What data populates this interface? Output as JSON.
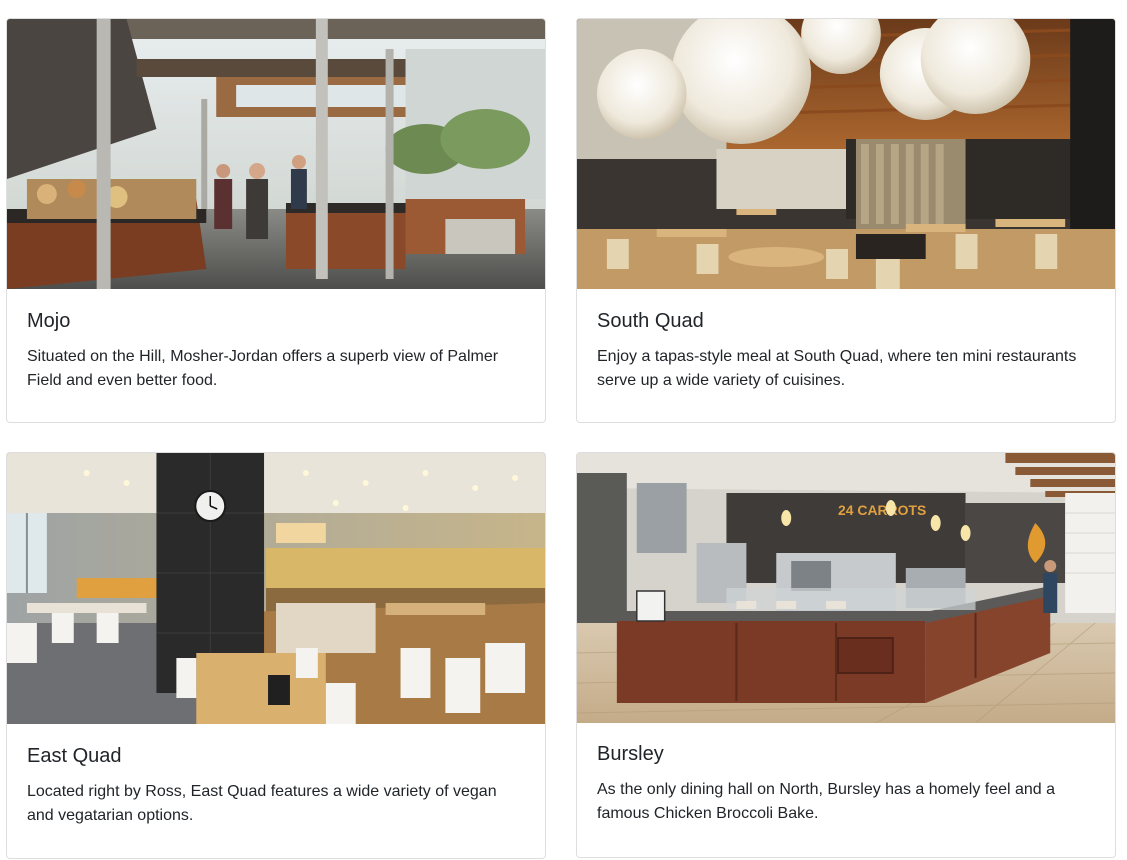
{
  "cards": [
    {
      "title": "Mojo",
      "text": "Situated on the Hill, Mosher-Jordan offers a superb view of Palmer Field and even better food.",
      "image": "mojo-dining-hall-photo"
    },
    {
      "title": "South Quad",
      "text": "Enjoy a tapas-style meal at South Quad, where ten mini restaurants serve up a wide variety of cuisines.",
      "image": "south-quad-dining-hall-photo"
    },
    {
      "title": "East Quad",
      "text": "Located right by Ross, East Quad features a wide variety of vegan and vegatarian options.",
      "image": "east-quad-dining-hall-photo"
    },
    {
      "title": "Bursley",
      "text": "As the only dining hall on North, Bursley has a homely feel and a famous Chicken Broccoli Bake.",
      "image": "bursley-dining-hall-photo",
      "sign_text": "24 CARROTS"
    }
  ]
}
